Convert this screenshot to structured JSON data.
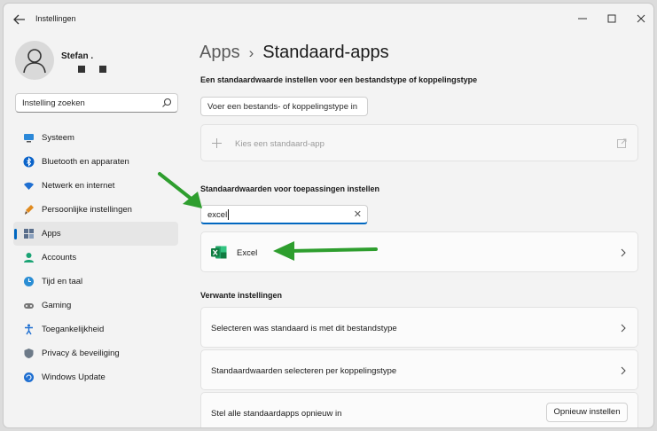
{
  "window": {
    "title": "Instellingen"
  },
  "profile": {
    "name": "Stefan ."
  },
  "sidebar": {
    "search_placeholder": "Instelling zoeken",
    "items": [
      {
        "label": "Systeem",
        "icon": "monitor-icon"
      },
      {
        "label": "Bluetooth en apparaten",
        "icon": "bluetooth-icon"
      },
      {
        "label": "Netwerk en internet",
        "icon": "wifi-icon"
      },
      {
        "label": "Persoonlijke instellingen",
        "icon": "brush-icon"
      },
      {
        "label": "Apps",
        "icon": "apps-icon",
        "active": true
      },
      {
        "label": "Accounts",
        "icon": "person-icon"
      },
      {
        "label": "Tijd en taal",
        "icon": "globe-clock-icon"
      },
      {
        "label": "Gaming",
        "icon": "gamepad-icon"
      },
      {
        "label": "Toegankelijkheid",
        "icon": "accessibility-icon"
      },
      {
        "label": "Privacy & beveiliging",
        "icon": "shield-icon"
      },
      {
        "label": "Windows Update",
        "icon": "update-icon"
      }
    ]
  },
  "breadcrumb": {
    "parent": "Apps",
    "separator": "›",
    "current": "Standaard-apps"
  },
  "filetype_section": {
    "heading": "Een standaardwaarde instellen voor een bestandstype of koppelingstype",
    "placeholder": "Voer een bestands- of koppelingstype in",
    "choose_app_label": "Kies een standaard-app"
  },
  "apps_section": {
    "heading": "Standaardwaarden voor toepassingen instellen",
    "search_value": "excel",
    "result_label": "Excel"
  },
  "related": {
    "heading": "Verwante instellingen",
    "items": [
      {
        "label": "Selecteren was standaard is met dit bestandstype"
      },
      {
        "label": "Standaardwaarden selecteren per koppelingstype"
      }
    ],
    "reset_label": "Stel alle standaardapps opnieuw in",
    "reset_button": "Opnieuw instellen"
  },
  "colors": {
    "accent": "#0067c0",
    "annotation_arrow": "#2e9e2e",
    "excel_green": "#107c41"
  }
}
